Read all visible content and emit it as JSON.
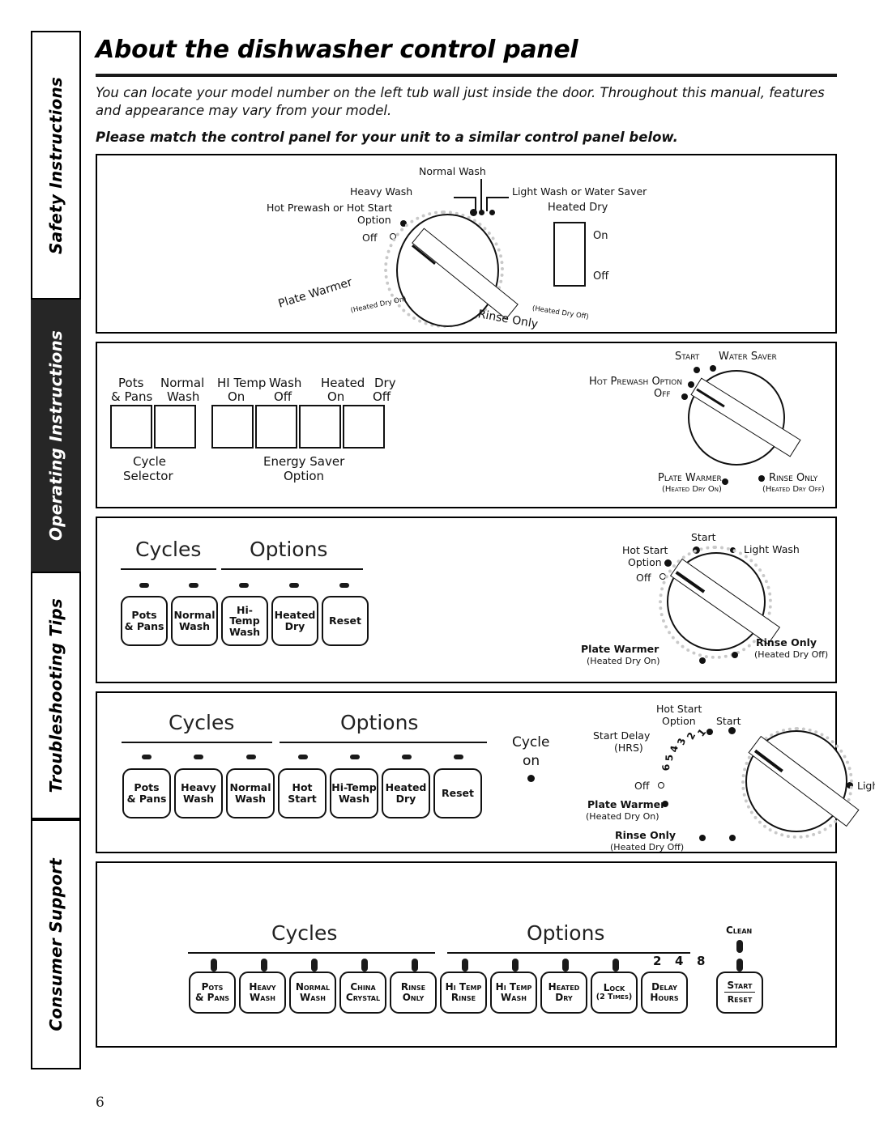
{
  "page": {
    "number": "6",
    "title": "About the dishwasher control panel",
    "intro_1": "You can locate your model number on the left tub wall just inside the door. Throughout this manual, features and appearance may vary from your model.",
    "intro_2": "Please match the control panel for your unit to a similar control panel below."
  },
  "sidebar": {
    "tabs": [
      {
        "label": "Safety Instructions",
        "active": false
      },
      {
        "label": "Operating Instructions",
        "active": true
      },
      {
        "label": "Troubleshooting Tips",
        "active": false
      },
      {
        "label": "Consumer Support",
        "active": false
      }
    ]
  },
  "panels": [
    {
      "id": "panel-1",
      "knob_labels": {
        "normal_wash": "Normal Wash",
        "heavy_wash": "Heavy Wash",
        "light_wash": "Light Wash or Water Saver",
        "hot_prewash_line1": "Hot Prewash or Hot Start",
        "hot_prewash_line2": "Option",
        "off": "Off",
        "plate_warmer": "Plate Warmer",
        "plate_warmer_sub": "(Heated Dry On)",
        "rinse_only": "Rinse Only",
        "rinse_only_sub": "(Heated Dry Off)"
      },
      "heated_dry": {
        "title": "Heated Dry",
        "on": "On",
        "off": "Off"
      }
    },
    {
      "id": "panel-2",
      "buttons": [
        {
          "line1": "Pots",
          "line2": "& Pans"
        },
        {
          "line1": "Normal",
          "line2": "Wash"
        },
        {
          "line1": "HI Temp",
          "line2": "On"
        },
        {
          "line1": "Wash",
          "line2": "Off"
        },
        {
          "line1": "Heated",
          "line2": "On"
        },
        {
          "line1": "Dry",
          "line2": "Off"
        }
      ],
      "group_left_line1": "Cycle",
      "group_left_line2": "Selector",
      "group_right_line1": "Energy Saver",
      "group_right_line2": "Option",
      "knob_labels": {
        "start": "Start",
        "water_saver": "Water Saver",
        "hot_prewash": "Hot Prewash Option",
        "off": "Off",
        "plate_warmer": "Plate Warmer",
        "plate_warmer_sub": "(Heated Dry On)",
        "rinse_only": "Rinse Only",
        "rinse_only_sub": "(Heated Dry Off)"
      }
    },
    {
      "id": "panel-3",
      "heading_cycles": "Cycles",
      "heading_options": "Options",
      "buttons": [
        {
          "line1": "Pots",
          "line2": "& Pans"
        },
        {
          "line1": "Normal",
          "line2": "Wash"
        },
        {
          "line1": "Hi-Temp",
          "line2": "Wash"
        },
        {
          "line1": "Heated",
          "line2": "Dry"
        },
        {
          "line1": "Reset",
          "line2": ""
        }
      ],
      "knob_labels": {
        "start": "Start",
        "hot_start_line1": "Hot Start",
        "hot_start_line2": "Option",
        "light_wash": "Light Wash",
        "off": "Off",
        "plate_warmer": "Plate Warmer",
        "plate_warmer_sub": "(Heated Dry On)",
        "rinse_only": "Rinse Only",
        "rinse_only_sub": "(Heated Dry Off)"
      }
    },
    {
      "id": "panel-4",
      "heading_cycles": "Cycles",
      "heading_options": "Options",
      "cycle_on_line1": "Cycle",
      "cycle_on_line2": "on",
      "buttons": [
        {
          "line1": "Pots",
          "line2": "& Pans"
        },
        {
          "line1": "Heavy",
          "line2": "Wash"
        },
        {
          "line1": "Normal",
          "line2": "Wash"
        },
        {
          "line1": "Hot",
          "line2": "Start"
        },
        {
          "line1": "Hi-Temp",
          "line2": "Wash"
        },
        {
          "line1": "Heated",
          "line2": "Dry"
        },
        {
          "line1": "Reset",
          "line2": ""
        }
      ],
      "knob_labels": {
        "start": "Start",
        "hot_start_line1": "Hot Start",
        "hot_start_line2": "Option",
        "start_delay_line1": "Start Delay",
        "start_delay_line2": "(HRS)",
        "delay_numbers": [
          "1",
          "2",
          "3",
          "4",
          "5",
          "6"
        ],
        "light_wash": "Light Wash",
        "off": "Off",
        "plate_warmer": "Plate Warmer",
        "plate_warmer_sub": "(Heated Dry On)",
        "rinse_only": "Rinse Only",
        "rinse_only_sub": "(Heated Dry Off)"
      }
    },
    {
      "id": "panel-5",
      "heading_cycles": "Cycles",
      "heading_options": "Options",
      "clean_label": "Clean",
      "delay_numbers": [
        "2",
        "4",
        "8"
      ],
      "buttons": [
        {
          "line1": "Pots",
          "line2": "& Pans"
        },
        {
          "line1": "Heavy",
          "line2": "Wash"
        },
        {
          "line1": "Normal",
          "line2": "Wash"
        },
        {
          "line1": "China",
          "line2": "Crystal"
        },
        {
          "line1": "Rinse",
          "line2": "Only"
        },
        {
          "line1": "Hi Temp",
          "line2": "Rinse"
        },
        {
          "line1": "Hi Temp",
          "line2": "Wash"
        },
        {
          "line1": "Heated",
          "line2": "Dry"
        },
        {
          "line1": "Lock",
          "line2": "(2 Times)"
        },
        {
          "line1": "Delay",
          "line2": "Hours"
        }
      ],
      "start_button": {
        "line1": "Start",
        "line2": "Reset"
      }
    }
  ]
}
